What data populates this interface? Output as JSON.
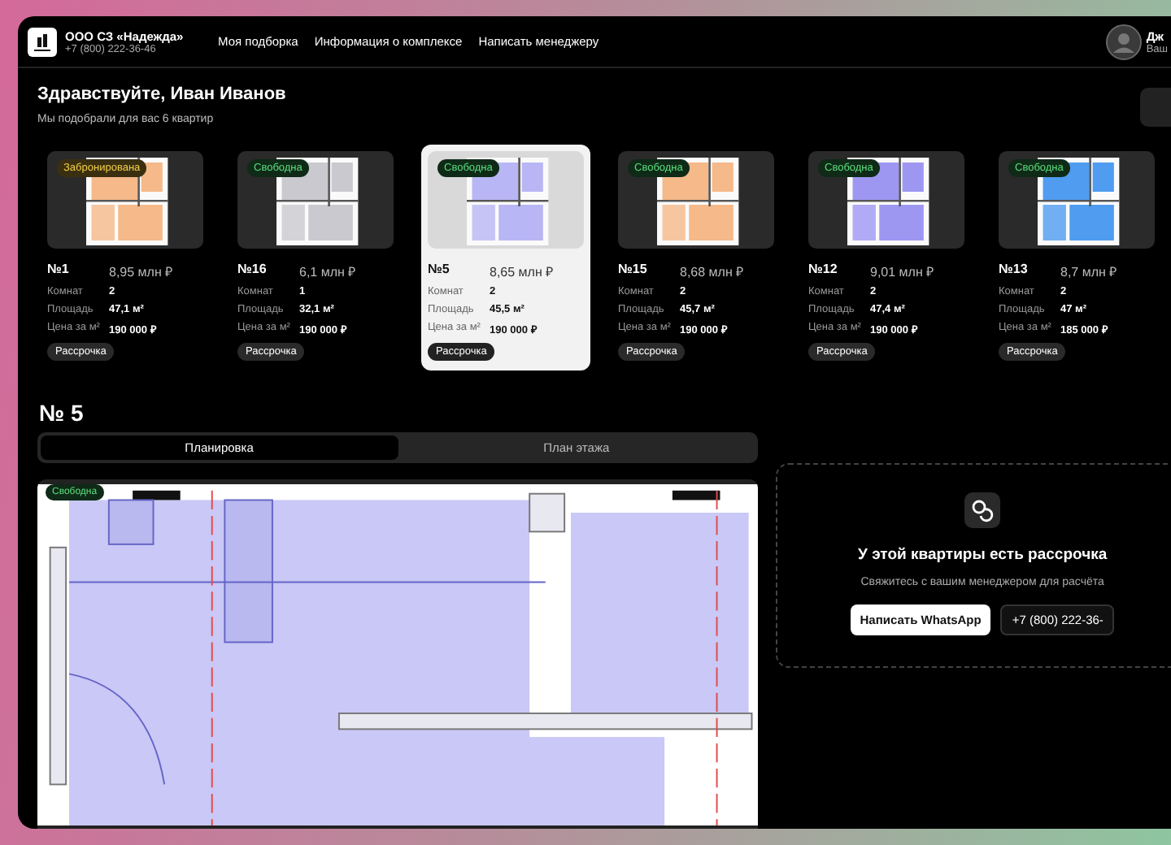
{
  "header": {
    "company": "ООО СЗ «Надежда»",
    "phone": "+7 (800) 222-36-46",
    "nav": [
      {
        "label": "Моя подборка"
      },
      {
        "label": "Информация о комплексе"
      },
      {
        "label": "Написать менеджеру"
      }
    ],
    "user": {
      "name": "Дж",
      "subtitle": "Ваш"
    }
  },
  "greeting": {
    "title": "Здравствуйте, Иван Иванов",
    "subtitle": "Мы подобрали для вас 6 квартир"
  },
  "apartments": [
    {
      "number": "№1",
      "price": "8,95 млн ₽",
      "rooms_label": "Комнат",
      "rooms": "2",
      "area_label": "Площадь",
      "area": "47,1 м²",
      "price_per_m_label": "Цена за м²",
      "price_per_m": "190 000 ₽",
      "tag": "Рассрочка",
      "status": {
        "text": "Забронирована",
        "kind": "reserved"
      },
      "selected": false
    },
    {
      "number": "№16",
      "price": "6,1 млн ₽",
      "rooms_label": "Комнат",
      "rooms": "1",
      "area_label": "Площадь",
      "area": "32,1 м²",
      "price_per_m_label": "Цена за м²",
      "price_per_m": "190 000 ₽",
      "tag": "Рассрочка",
      "status": {
        "text": "Свободна",
        "kind": "free"
      },
      "selected": false
    },
    {
      "number": "№5",
      "price": "8,65 млн ₽",
      "rooms_label": "Комнат",
      "rooms": "2",
      "area_label": "Площадь",
      "area": "45,5 м²",
      "price_per_m_label": "Цена за м²",
      "price_per_m": "190 000 ₽",
      "tag": "Рассрочка",
      "status": {
        "text": "Свободна",
        "kind": "free"
      },
      "selected": true
    },
    {
      "number": "№15",
      "price": "8,68 млн ₽",
      "rooms_label": "Комнат",
      "rooms": "2",
      "area_label": "Площадь",
      "area": "45,7 м²",
      "price_per_m_label": "Цена за м²",
      "price_per_m": "190 000 ₽",
      "tag": "Рассрочка",
      "status": {
        "text": "Свободна",
        "kind": "free"
      },
      "selected": false
    },
    {
      "number": "№12",
      "price": "9,01 млн ₽",
      "rooms_label": "Комнат",
      "rooms": "2",
      "area_label": "Площадь",
      "area": "47,4 м²",
      "price_per_m_label": "Цена за м²",
      "price_per_m": "190 000 ₽",
      "tag": "Рассрочка",
      "status": {
        "text": "Свободна",
        "kind": "free"
      },
      "selected": false
    },
    {
      "number": "№13",
      "price": "8,7 млн ₽",
      "rooms_label": "Комнат",
      "rooms": "2",
      "area_label": "Площадь",
      "area": "47 м²",
      "price_per_m_label": "Цена за м²",
      "price_per_m": "185 000 ₽",
      "tag": "Рассрочка",
      "status": {
        "text": "Свободна",
        "kind": "free"
      },
      "selected": false
    }
  ],
  "detail": {
    "title": "№ 5",
    "tabs": [
      {
        "label": "Планировка",
        "selected": true
      },
      {
        "label": "План этажа",
        "selected": false
      }
    ],
    "status": {
      "text": "Свободна",
      "kind": "free"
    }
  },
  "installment": {
    "title": "У этой квартиры есть рассрочка",
    "text": "Свяжитесь с вашим менеджером для расчёта",
    "whatsapp": "Написать WhatsApp",
    "phone": "+7 (800) 222-36-"
  }
}
